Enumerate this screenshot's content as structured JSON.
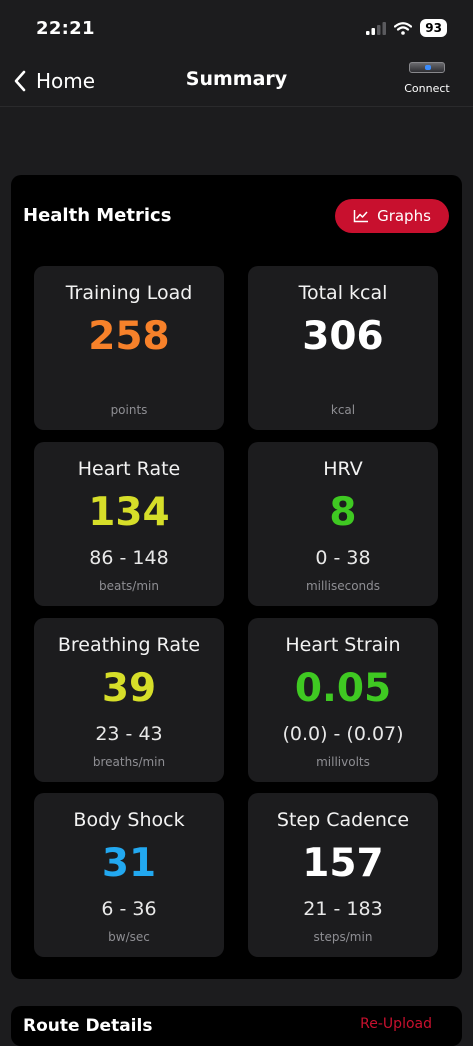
{
  "status_bar": {
    "time": "22:21",
    "battery": "93"
  },
  "nav": {
    "back_label": "Home",
    "title": "Summary",
    "connect_label": "Connect"
  },
  "health_metrics": {
    "title": "Health Metrics",
    "graphs_button": "Graphs",
    "accent_color": "#c8102e",
    "tiles": [
      {
        "label": "Training Load",
        "value": "258",
        "range": "",
        "unit": "points",
        "color": "#f7812a"
      },
      {
        "label": "Total kcal",
        "value": "306",
        "range": "",
        "unit": "kcal",
        "color": "#ffffff"
      },
      {
        "label": "Heart Rate",
        "value": "134",
        "range": "86 - 148",
        "unit": "beats/min",
        "color": "#d6de29"
      },
      {
        "label": "HRV",
        "value": "8",
        "range": "0 - 38",
        "unit": "milliseconds",
        "color": "#3fc922"
      },
      {
        "label": "Breathing Rate",
        "value": "39",
        "range": "23 - 43",
        "unit": "breaths/min",
        "color": "#d6de29"
      },
      {
        "label": "Heart Strain",
        "value": "0.05",
        "range": "(0.0) - (0.07)",
        "unit": "millivolts",
        "color": "#3fc922"
      },
      {
        "label": "Body Shock",
        "value": "31",
        "range": "6 - 36",
        "unit": "bw/sec",
        "color": "#22a8f0"
      },
      {
        "label": "Step Cadence",
        "value": "157",
        "range": "21 - 183",
        "unit": "steps/min",
        "color": "#ffffff"
      }
    ]
  },
  "route_details": {
    "title": "Route Details",
    "action": "Re-Upload"
  }
}
